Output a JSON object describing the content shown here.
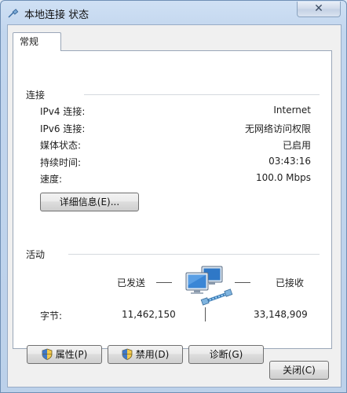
{
  "window": {
    "title": "本地连接 状态",
    "close_glyph": "✕"
  },
  "tabs": [
    {
      "label": "常规"
    }
  ],
  "connection": {
    "heading": "连接",
    "rows": [
      {
        "label": "IPv4 连接:",
        "value": "Internet"
      },
      {
        "label": "IPv6 连接:",
        "value": "无网络访问权限"
      },
      {
        "label": "媒体状态:",
        "value": "已启用"
      },
      {
        "label": "持续时间:",
        "value": "03:43:16"
      },
      {
        "label": "速度:",
        "value": "100.0 Mbps"
      }
    ],
    "details_button": "详细信息(E)..."
  },
  "activity": {
    "heading": "活动",
    "sent_label": "已发送",
    "received_label": "已接收",
    "bytes_label": "字节:",
    "bytes_sent": "11,462,150",
    "bytes_received": "33,148,909"
  },
  "buttons": {
    "properties": "属性(P)",
    "disable": "禁用(D)",
    "diagnose": "诊断(G)",
    "close": "关闭(C)"
  }
}
